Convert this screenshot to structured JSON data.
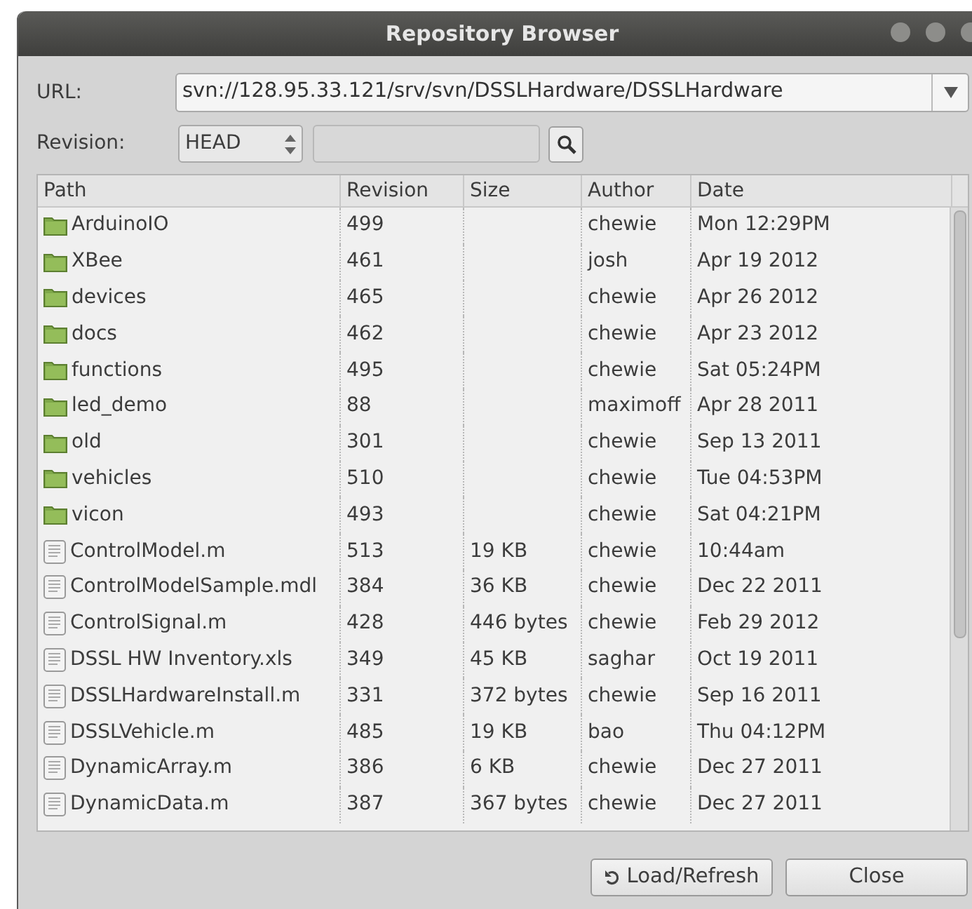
{
  "window": {
    "title": "Repository Browser"
  },
  "url": {
    "label": "URL:",
    "value": "svn://128.95.33.121/srv/svn/DSSLHardware/DSSLHardware"
  },
  "revision": {
    "label": "Revision:",
    "value": "HEAD"
  },
  "table": {
    "columns": [
      "Path",
      "Revision",
      "Size",
      "Author",
      "Date"
    ],
    "rows": [
      {
        "kind": "folder",
        "cells": [
          "ArduinoIO",
          "499",
          "",
          "chewie",
          "Mon 12:29PM"
        ]
      },
      {
        "kind": "folder",
        "cells": [
          "XBee",
          "461",
          "",
          "josh",
          "Apr 19 2012"
        ]
      },
      {
        "kind": "folder",
        "cells": [
          "devices",
          "465",
          "",
          "chewie",
          "Apr 26 2012"
        ]
      },
      {
        "kind": "folder",
        "cells": [
          "docs",
          "462",
          "",
          "chewie",
          "Apr 23 2012"
        ]
      },
      {
        "kind": "folder",
        "cells": [
          "functions",
          "495",
          "",
          "chewie",
          "Sat 05:24PM"
        ]
      },
      {
        "kind": "folder",
        "cells": [
          "led_demo",
          "88",
          "",
          "maximoff",
          "Apr 28 2011"
        ]
      },
      {
        "kind": "folder",
        "cells": [
          "old",
          "301",
          "",
          "chewie",
          "Sep 13 2011"
        ]
      },
      {
        "kind": "folder",
        "cells": [
          "vehicles",
          "510",
          "",
          "chewie",
          "Tue 04:53PM"
        ]
      },
      {
        "kind": "folder",
        "cells": [
          "vicon",
          "493",
          "",
          "chewie",
          "Sat 04:21PM"
        ]
      },
      {
        "kind": "file",
        "cells": [
          "ControlModel.m",
          "513",
          "19 KB",
          "chewie",
          "10:44am"
        ]
      },
      {
        "kind": "file",
        "cells": [
          "ControlModelSample.mdl",
          "384",
          "36 KB",
          "chewie",
          "Dec 22 2011"
        ]
      },
      {
        "kind": "file",
        "cells": [
          "ControlSignal.m",
          "428",
          "446 bytes",
          "chewie",
          "Feb 29 2012"
        ]
      },
      {
        "kind": "file",
        "cells": [
          "DSSL HW Inventory.xls",
          "349",
          "45 KB",
          "saghar",
          "Oct 19 2011"
        ]
      },
      {
        "kind": "file",
        "cells": [
          "DSSLHardwareInstall.m",
          "331",
          "372 bytes",
          "chewie",
          "Sep 16 2011"
        ]
      },
      {
        "kind": "file",
        "cells": [
          "DSSLVehicle.m",
          "485",
          "19 KB",
          "bao",
          "Thu 04:12PM"
        ]
      },
      {
        "kind": "file",
        "cells": [
          "DynamicArray.m",
          "386",
          "6 KB",
          "chewie",
          "Dec 27 2011"
        ]
      },
      {
        "kind": "file",
        "cells": [
          "DynamicData.m",
          "387",
          "367 bytes",
          "chewie",
          "Dec 27 2011"
        ]
      }
    ]
  },
  "buttons": [
    {
      "kind": "refresh",
      "label": "Load/Refresh"
    },
    {
      "kind": "plain",
      "label": "Close"
    }
  ]
}
